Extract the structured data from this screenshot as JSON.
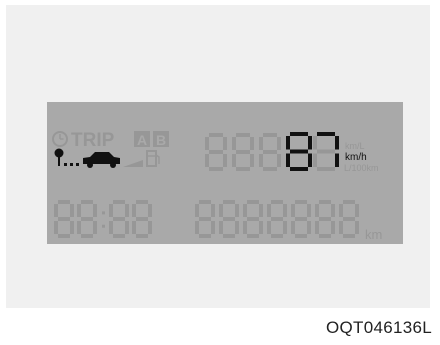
{
  "image_code": "OQT046136L",
  "display": {
    "mode_label": "TRIP",
    "trip_a": "A",
    "trip_b": "B",
    "speed_value": "87",
    "unit_active": "km/h",
    "unit_km_per_l": "km/L",
    "unit_l_per_100km": "L/100km",
    "odo_unit": "km"
  }
}
